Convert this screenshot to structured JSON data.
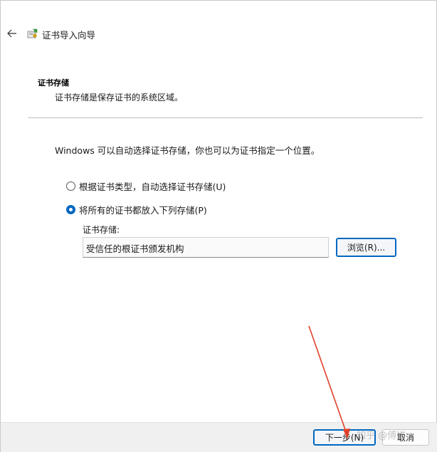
{
  "wizard": {
    "title": "证书导入向导",
    "back_icon": "arrow-left-icon",
    "app_icon": "certificate-icon"
  },
  "header": {
    "title": "证书存储",
    "description": "证书存储是保存证书的系统区域。"
  },
  "body": {
    "intro": "Windows 可以自动选择证书存储，你也可以为证书指定一个位置。",
    "options": [
      {
        "label": "根据证书类型，自动选择证书存储(U)",
        "checked": false
      },
      {
        "label": "将所有的证书都放入下列存储(P)",
        "checked": true
      }
    ],
    "store_label": "证书存储:",
    "store_value": "受信任的根证书颁发机构",
    "browse_label": "浏览(R)..."
  },
  "footer": {
    "next_label": "下一步(N)",
    "cancel_label": "取消"
  },
  "watermark": "知乎 @傅嫌",
  "colors": {
    "accent": "#0067c0",
    "annotation_arrow": "#e0402a"
  }
}
